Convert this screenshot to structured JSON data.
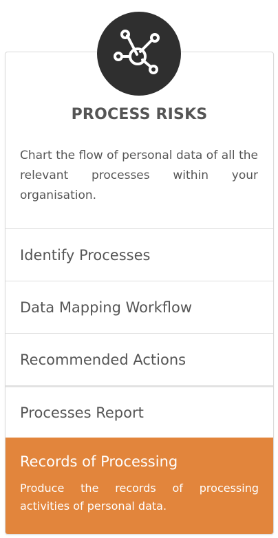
{
  "panel": {
    "icon": "process-network-icon",
    "title": "PROCESS RISKS",
    "description": "Chart the flow of personal data of all the relevant processes within your organisation."
  },
  "menu": {
    "items": [
      {
        "label": "Identify Processes"
      },
      {
        "label": "Data Mapping Workflow"
      },
      {
        "label": "Recommended Actions"
      },
      {
        "label": "Processes Report"
      }
    ],
    "active": {
      "label": "Records of Processing",
      "description": "Produce the records of processing activities of personal data."
    }
  },
  "colors": {
    "accent": "#e2853c",
    "icon_circle": "#2f2f2f",
    "text": "#555555"
  }
}
